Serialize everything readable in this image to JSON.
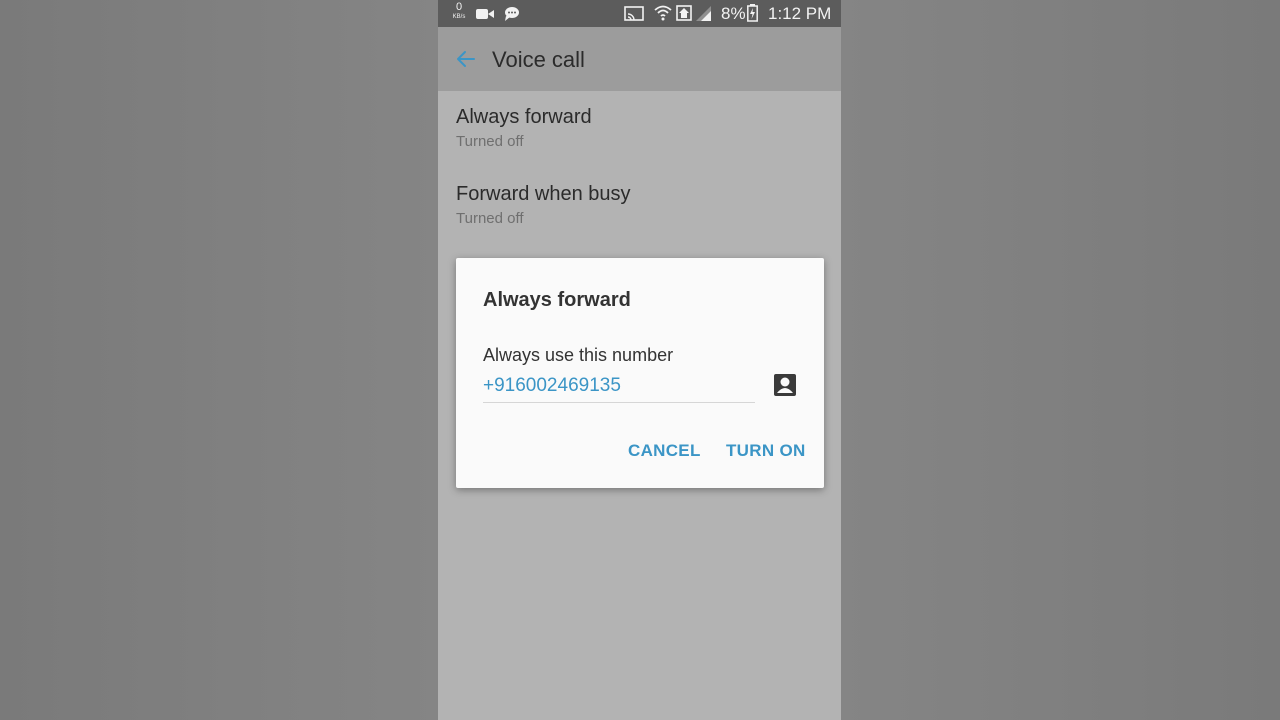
{
  "status_bar": {
    "data_speed_value": "0",
    "data_speed_unit": "KB/s",
    "battery_percent": "8%",
    "time": "1:12 PM",
    "icons": [
      "video-icon",
      "chat-icon",
      "cast-icon",
      "wifi-icon",
      "home-icon",
      "signal-icon",
      "battery-icon"
    ]
  },
  "app_bar": {
    "title": "Voice call",
    "back_icon": "arrow-left-icon",
    "accent": "#3b95c6"
  },
  "settings": {
    "items": [
      {
        "title": "Always forward",
        "subtitle": "Turned off"
      },
      {
        "title": "Forward when busy",
        "subtitle": "Turned off"
      }
    ]
  },
  "dialog": {
    "title": "Always forward",
    "label": "Always use this number",
    "number_value": "+916002469135",
    "contact_icon": "contact-icon",
    "cancel_label": "CANCEL",
    "confirm_label": "TURN ON"
  }
}
